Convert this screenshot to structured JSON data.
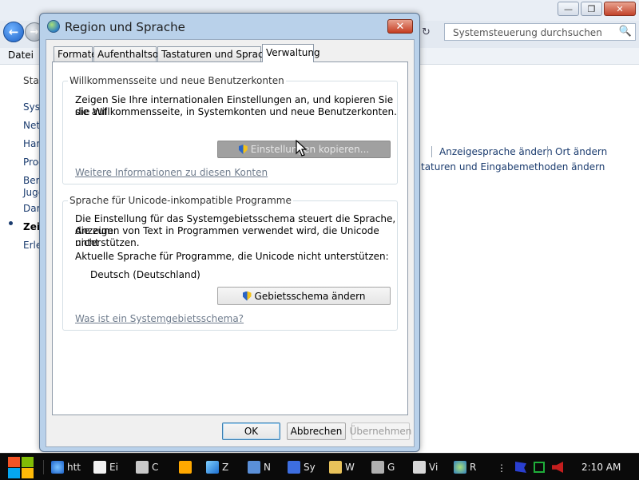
{
  "background_window": {
    "window_controls": {
      "minimize": "—",
      "maximize": "❐",
      "close": "✕"
    },
    "nav": {
      "back": "←",
      "forward": "→",
      "refresh": "↻"
    },
    "search": {
      "placeholder": "Systemsteuerung durchsuchen",
      "icon": "🔍"
    },
    "menu": {
      "datei": "Datei"
    },
    "sidebar_items": [
      "Star",
      "Syst",
      "Netz",
      "Harc",
      "Prog",
      "Ben",
      "Juge",
      "Dars",
      "Zeit",
      "Erlei"
    ],
    "active_item": "Zeit",
    "links": {
      "anzeigesprache": "Anzeigesprache ändern",
      "ort": "Ort ändern",
      "tastaturen": "taturen und Eingabemethoden ändern"
    }
  },
  "dialog": {
    "title": "Region und Sprache",
    "close_label": "✕",
    "tabs": [
      "Formate",
      "Aufenthaltsort",
      "Tastaturen und Sprachen",
      "Verwaltung"
    ],
    "active_tab": "Verwaltung",
    "group_welcome": {
      "title": "Willkommensseite und neue Benutzerkonten",
      "text_line1": "Zeigen Sie Ihre internationalen Einstellungen an, und kopieren Sie sie auf",
      "text_line2": "die Willkommensseite, in Systemkonten und neue Benutzerkonten.",
      "button": "Einstellungen kopieren...",
      "link": "Weitere Informationen zu diesen Konten"
    },
    "group_unicode": {
      "title": "Sprache für Unicode-inkompatible Programme",
      "text_line1": "Die Einstellung für das Systemgebietsschema steuert die Sprache, die zum",
      "text_line2": "Anzeigen von Text in Programmen verwendet wird, die Unicode nicht",
      "text_line3": "unterstützen.",
      "current_label": "Aktuelle Sprache für Programme, die Unicode nicht unterstützen:",
      "current_value": "Deutsch (Deutschland)",
      "button": "Gebietsschema ändern",
      "link": "Was ist ein Systemgebietsschema?"
    },
    "buttons": {
      "ok": "OK",
      "cancel": "Abbrechen",
      "apply": "Übernehmen"
    }
  },
  "taskbar": {
    "items": [
      "htt",
      "Ei",
      "C",
      "",
      "Z",
      "N",
      "Sy",
      "W",
      "G",
      "Vi",
      "R"
    ],
    "overflow": "⋮",
    "clock": "2:10 AM"
  },
  "colors": {
    "dialog_frame": "#b9d1ea",
    "link": "#6e7b8c",
    "taskbar": "#0a0a0a"
  }
}
